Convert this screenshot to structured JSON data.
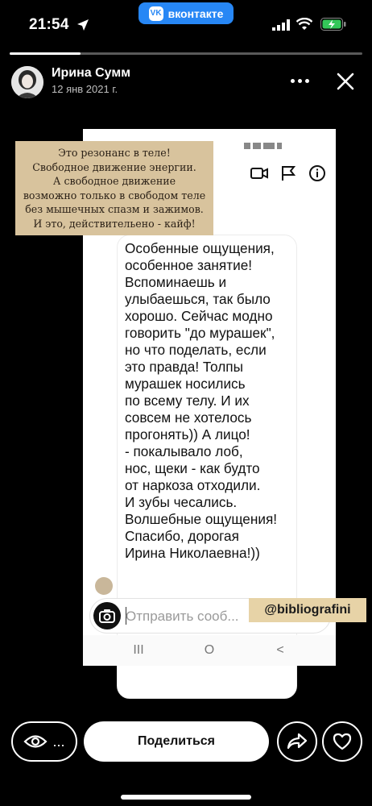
{
  "status_bar": {
    "time": "21:54",
    "app_pill": "вконтакте",
    "vk_logo": "VK"
  },
  "story": {
    "progress": 0.2
  },
  "author": {
    "name": "Ирина Сумм",
    "date": "12 янв 2021 г."
  },
  "quote": {
    "text": "Это резонанс в теле!\nСвободное движение энергии.\nА свободное движение\nвозможно только в свободом теле\nбез мышечных спазм и зажимов.\nИ это, действительено - кайф!"
  },
  "message": {
    "text": "Особенные ощущения,\nособенное занятие!\nВспоминаешь и\nулыбаешься, так было\nхорошо. Сейчас модно\nговорить \"до мурашек\",\nно что поделать, если\nэто правда! Толпы\nмурашек  носились\nпо всему телу. И их\nсовсем не хотелось\nпрогонять)) А лицо!\n-  покалывало лоб,\nнос, щеки - как будто\nот наркоза отходили.\nИ зубы чесались.\nВолшебные ощущения!\nСпасибо, дорогая\nИрина Николаевна!))"
  },
  "composer": {
    "placeholder": "Отправить сооб..."
  },
  "tag": {
    "label": "@bibliografini"
  },
  "nav": {
    "recent": "III",
    "home": "O",
    "back": "<"
  },
  "bottom": {
    "views_more": "...",
    "share_label": "Поделиться"
  }
}
